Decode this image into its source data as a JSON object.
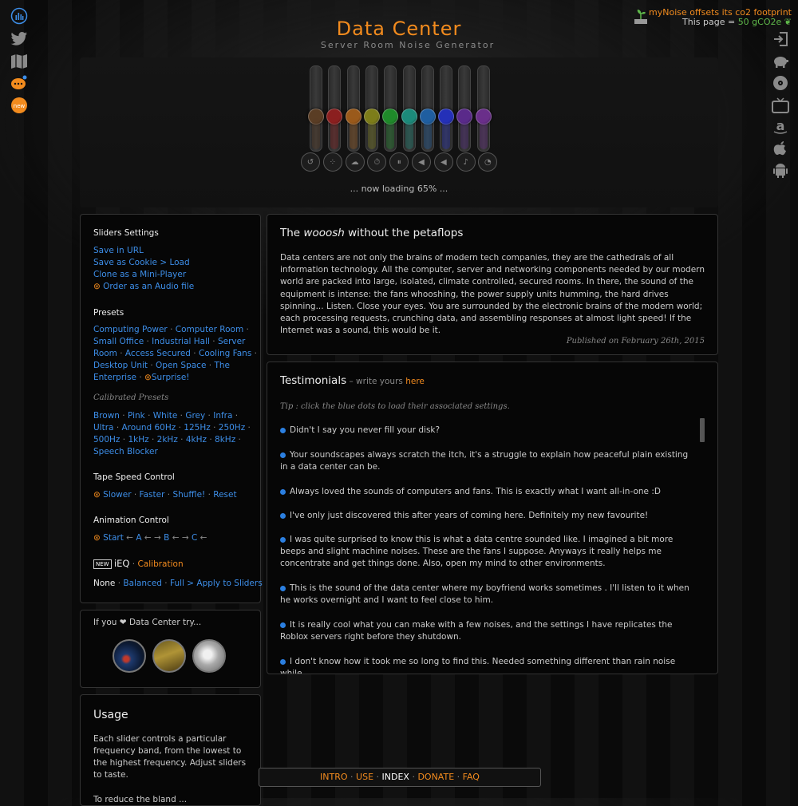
{
  "header": {
    "title": "Data Center",
    "subtitle": "Server Room Noise Generator",
    "co2_line1": "myNoise offsets its co2 footprint",
    "co2_line2_prefix": "This page = ",
    "co2_value": "50 gCO2e"
  },
  "mixer": {
    "slider_colors": [
      "#5a3d24",
      "#8b1f1f",
      "#9a5a1b",
      "#7d7d1a",
      "#1f8a2a",
      "#1c8a7a",
      "#1f5ea0",
      "#2430b8",
      "#5a2a8a",
      "#6a2f8a"
    ],
    "slider_levels_percent": [
      40,
      40,
      40,
      40,
      40,
      40,
      40,
      40,
      40,
      40
    ],
    "controls": [
      "reset-icon",
      "randomize-icon",
      "animate-icon",
      "timer-icon",
      "pause-icon",
      "mute-icon",
      "volume-icon",
      "bell-icon",
      "calibration-icon"
    ],
    "loading_text": "... now loading 65% ..."
  },
  "sliders_settings": {
    "heading": "Sliders Settings",
    "save_url": "Save in URL",
    "save_cookie": "Save as Cookie > Load",
    "clone": "Clone as a Mini-Player",
    "order_audio": "Order as an Audio file"
  },
  "presets": {
    "heading": "Presets",
    "items": [
      "Computing Power",
      "Computer Room",
      "Small Office",
      "Industrial Hall",
      "Server",
      "Room",
      "Access Secured",
      "Cooling Fans",
      "Desktop Unit",
      "Open Space",
      "The",
      "Enterprise",
      "Surprise!"
    ],
    "calibrated_heading": "Calibrated Presets",
    "calibrated": [
      "Brown",
      "Pink",
      "White",
      "Grey",
      "Infra",
      "Ultra",
      "Around 60Hz",
      "125Hz",
      "250Hz",
      "500Hz",
      "1kHz",
      "2kHz",
      "4kHz",
      "8kHz",
      "Speech Blocker"
    ]
  },
  "tape_speed": {
    "heading": "Tape Speed Control",
    "items": [
      "Slower",
      "Faster",
      "Shuffle!",
      "Reset"
    ]
  },
  "animation": {
    "heading": "Animation Control",
    "start": "Start",
    "a": "A",
    "b": "B",
    "c": "C",
    "arrow_left": "←",
    "arrow_right": "→",
    "arrow_both": "← → "
  },
  "ieq": {
    "new_badge": "NEW",
    "label": "iEQ",
    "calibration": "Calibration",
    "none": "None",
    "balanced": "Balanced",
    "full": "Full > Apply to Sliders"
  },
  "try_box": {
    "prefix": "If you",
    "suffix": "Data Center try..."
  },
  "usage": {
    "heading": "Usage",
    "text": "Each slider controls a particular frequency band, from the lowest to the highest frequency. Adjust sliders to taste.",
    "text2": "To reduce the bland ..."
  },
  "article": {
    "title_prefix": "The ",
    "title_em": "wooosh",
    "title_suffix": " without the petaflops",
    "body": "Data centers are not only the brains of modern tech companies, they are the cathedrals of all information technology. All the computer, server and networking components needed by our modern world are packed into large, isolated, climate controlled, secured rooms. In there, the sound of the equipment is intense: the fans whooshing, the power supply units humming, the hard drives spinning... Listen. Close your eyes. You are surrounded by the electronic brains of the modern world; each processing requests, crunching data, and assembling responses at almost light speed! If the Internet was a sound, this would be it.",
    "published": "Published on February 26th, 2015"
  },
  "testimonials": {
    "heading": "Testimonials",
    "write_prefix": "– write yours ",
    "write_link": "here",
    "tip": "Tip : click the blue dots to load their associated settings.",
    "items": [
      "Didn't I say you never fill your disk?",
      "Your soundscapes always scratch the itch, it's a struggle to explain how peaceful plain existing in a data center can be.",
      "Always loved the sounds of computers and fans. This is exactly what I want all-in-one :D",
      "I've only just discovered this after years of coming here. Definitely my new favourite!",
      "I was quite surprised to know this is what a data centre sounded like. I imagined a bit more beeps and slight machine noises. These are the fans I suppose. Anyways it really helps me concentrate and get things done. Also, open my mind to other environments.",
      "This is the sound of the data center where my boyfriend works sometimes . I'll listen to it when he works overnight and I want to feel close to him.",
      "It is really cool what you can make with a few noises, and the settings I have replicates the Roblox servers right before they shutdown.",
      "I don't know how it took me so long to find this. Needed something different than rain noise while"
    ]
  },
  "footer": {
    "intro": "INTRO",
    "use": "USE",
    "index": "INDEX",
    "donate": "DONATE",
    "faq": "FAQ"
  },
  "left_icons": [
    "equalizer-icon",
    "twitter-icon",
    "map-icon",
    "chat-icon",
    "new-icon"
  ],
  "right_icons": [
    "login-icon",
    "piggybank-icon",
    "vinyl-icon",
    "tv-icon",
    "amazon-icon",
    "apple-icon",
    "android-icon"
  ]
}
